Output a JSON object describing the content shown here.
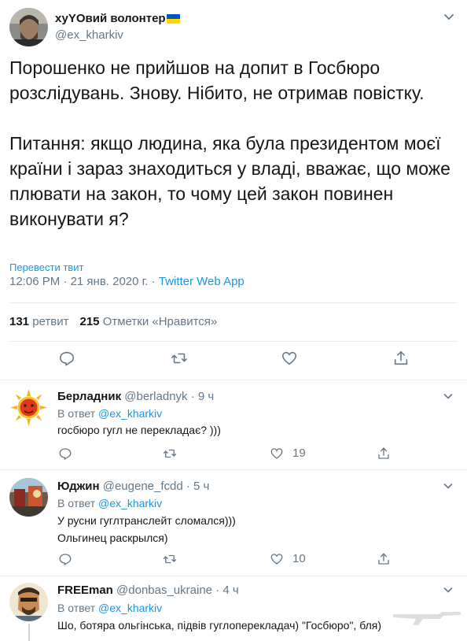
{
  "main_tweet": {
    "display_name": "хуYОвий волонтер",
    "handle": "@ex_kharkiv",
    "body": "Порошенко не прийшов на допит в Госбюро розслідувань. Знову. Нібито, не отримав повістку.\n\nПитання: якщо людина, яка була президентом моєї країни і зараз знаходиться у владі, вважає, що може плювати на закон, то чому цей закон повинен виконувати я?",
    "translate_label": "Перевести твит",
    "time": "12:06 PM",
    "separator": " · ",
    "date": "21 янв. 2020 г.",
    "app": "Twitter Web App",
    "retweets_count": "131",
    "retweets_label": "ретвит",
    "likes_count": "215",
    "likes_label": "Отметки «Нравится»",
    "flag_colors": [
      "#0057b7",
      "#ffd700"
    ]
  },
  "replies": [
    {
      "name": "Берладник",
      "handle": "@berladnyk",
      "time": " · 9 ч",
      "in_reply_prefix": "В ответ ",
      "in_reply_mention": "@ex_kharkiv",
      "text": "госбюро гугл не перекладає?  )))",
      "retweets": "",
      "likes": "19"
    },
    {
      "name": "Юджин",
      "handle": "@eugene_fcdd",
      "time": " · 5 ч",
      "in_reply_prefix": "В ответ ",
      "in_reply_mention": "@ex_kharkiv",
      "text": "У русни гуглтранслейт сломался)))\nОльгинец раскрылся)",
      "retweets": "",
      "likes": "10"
    },
    {
      "name": "FREEman",
      "handle": "@donbas_ukraine",
      "time": " · 4 ч",
      "in_reply_prefix": "В ответ ",
      "in_reply_mention": "@ex_kharkiv",
      "text": "Шо, ботяра ольгінська, підвів гуглоперекладач) \"Госбюро\", бля)"
    }
  ],
  "icons": {
    "reply": "reply-icon",
    "retweet": "retweet-icon",
    "like": "heart-icon",
    "share": "share-icon",
    "more": "chevron-down-icon"
  },
  "colors": {
    "link": "#1b95e0",
    "secondary": "#657786",
    "primary_text": "#14171a",
    "divider": "#e6ecf0"
  }
}
